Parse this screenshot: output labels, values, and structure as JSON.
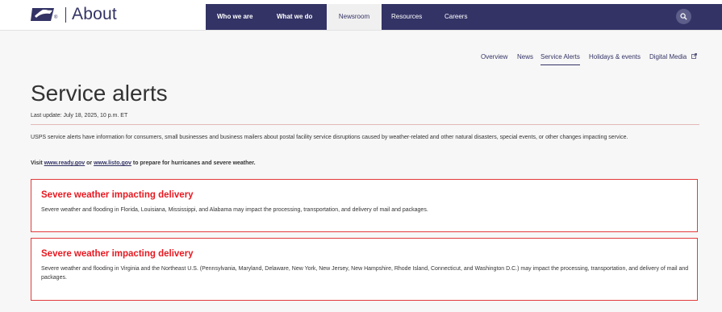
{
  "header": {
    "brand_title": "About",
    "registered_mark": "®",
    "nav": [
      {
        "label": "Who we are"
      },
      {
        "label": "What we do"
      },
      {
        "label": "Newsroom"
      },
      {
        "label": "Resources"
      },
      {
        "label": "Careers"
      }
    ],
    "active_nav": "Newsroom",
    "search_icon": "search-icon",
    "colors": {
      "brand_blue": "#333366",
      "alert_red": "#e71921"
    }
  },
  "subnav": {
    "items": [
      {
        "label": "Overview"
      },
      {
        "label": "News"
      },
      {
        "label": "Service Alerts"
      },
      {
        "label": "Holidays & events"
      },
      {
        "label": "Digital Media"
      }
    ],
    "active": "Service Alerts",
    "external_icon": "external-link-icon"
  },
  "main": {
    "title": "Service alerts",
    "last_update": "Last update: July 18, 2025, 10 p.m. ET",
    "intro": "USPS service alerts have information for consumers, small businesses and business mailers about postal facility service disruptions caused by weather-related and other natural disasters, special events, or other changes impacting service.",
    "visit_prefix": "Visit",
    "link1": "www.ready.gov",
    "visit_or": "or",
    "link2": "www.listo.gov",
    "visit_suffix": "to prepare for hurricanes and severe weather."
  },
  "alerts": [
    {
      "title": "Severe weather impacting delivery",
      "body": "Severe weather and flooding in Florida, Louisiana, Mississippi, and Alabama may impact the processing, transportation, and delivery of mail and packages."
    },
    {
      "title": "Severe weather impacting delivery",
      "body": "Severe weather and flooding in Virginia and the Northeast U.S. (Pennsylvania, Maryland, Delaware, New York, New Jersey, New Hampshire, Rhode Island, Connecticut, and Washington D.C.) may impact the processing, transportation, and delivery of mail and packages."
    }
  ]
}
